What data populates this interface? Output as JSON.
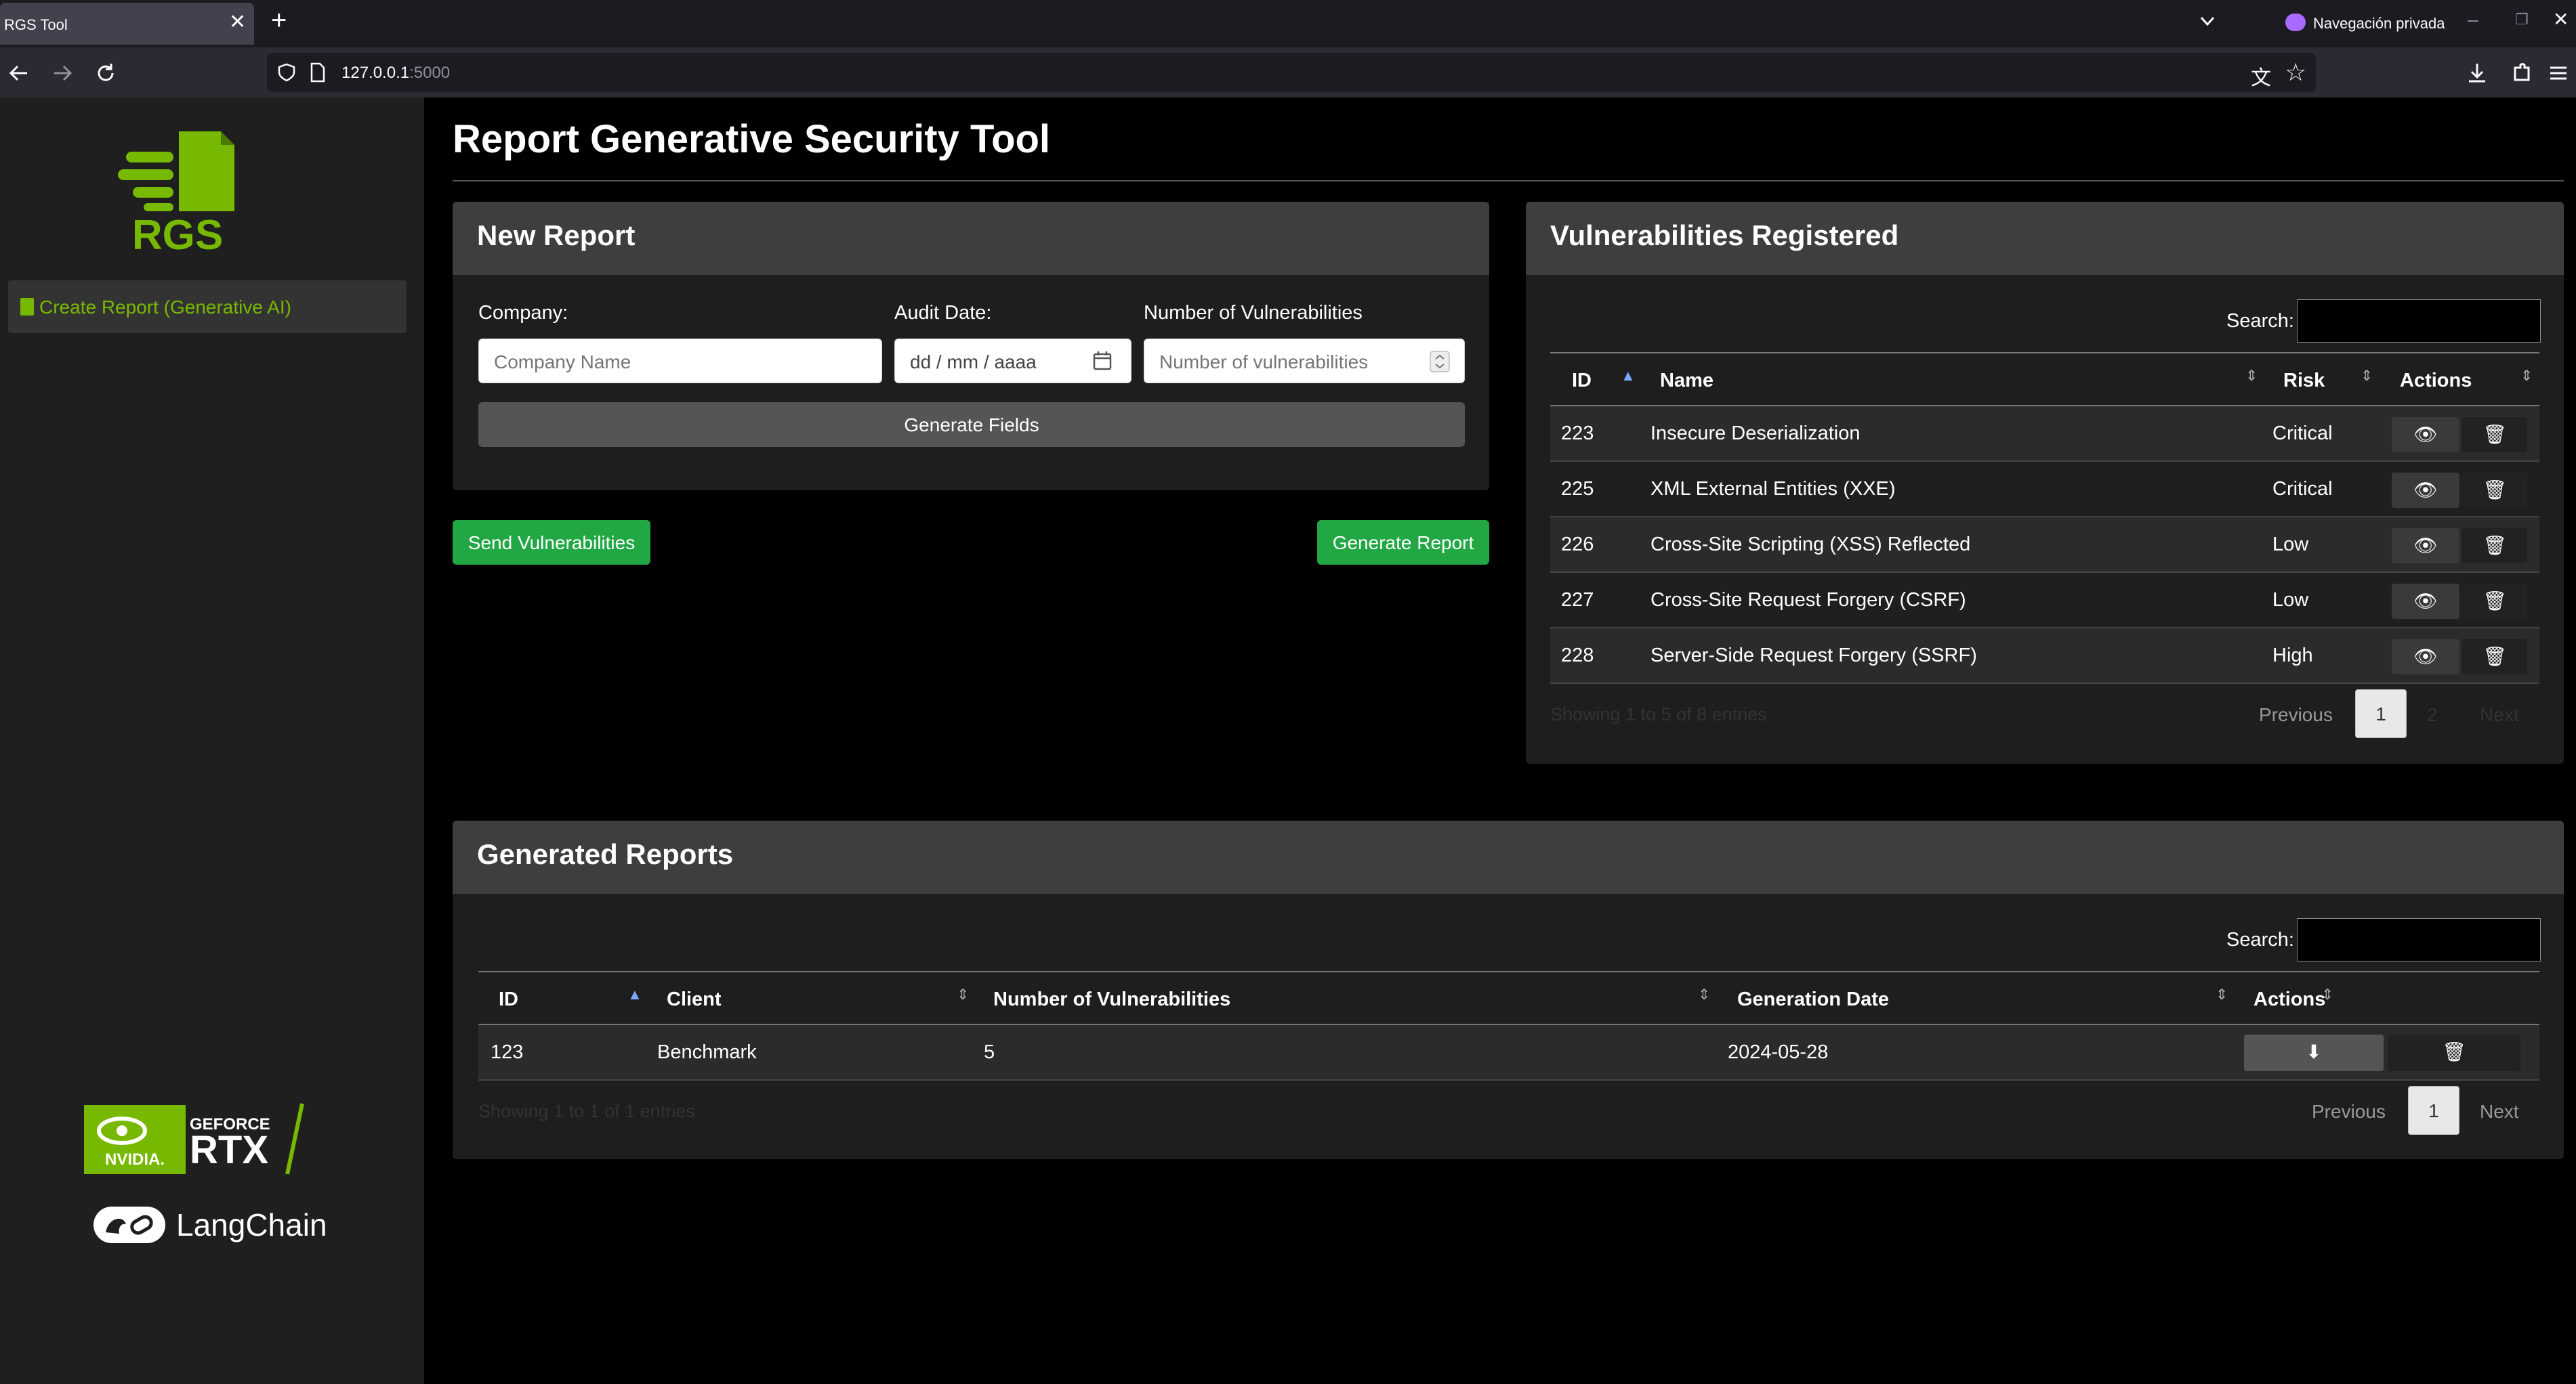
{
  "browser": {
    "tab_title": "RGS Tool",
    "tab_close": "✕",
    "new_tab": "+",
    "private_label": "Navegación privada",
    "url_host": "127.0.0.1",
    "url_port": ":5000"
  },
  "sidebar": {
    "logo_text": "RGS",
    "menu_item_label": "Create Report (Generative AI)",
    "nvidia_text": "NVIDIA.",
    "geforce_text": "GEFORCE",
    "rtx_text": "RTX",
    "langchain_text": "LangChain"
  },
  "page": {
    "title": "Report Generative Security Tool"
  },
  "new_report": {
    "title": "New Report",
    "company_label": "Company:",
    "company_placeholder": "Company Name",
    "audit_label": "Audit Date:",
    "audit_placeholder": "dd / mm / aaaa",
    "vuln_label": "Number of Vulnerabilities",
    "vuln_placeholder": "Number of vulnerabilities",
    "generate_fields": "Generate Fields",
    "send_vulns": "Send Vulnerabilities",
    "generate_report": "Generate Report"
  },
  "vulns": {
    "title": "Vulnerabilities Registered",
    "search_label": "Search:",
    "headers": {
      "id": "ID",
      "name": "Name",
      "risk": "Risk",
      "actions": "Actions"
    },
    "rows": [
      {
        "id": "223",
        "name": "Insecure Deserialization",
        "risk": "Critical"
      },
      {
        "id": "225",
        "name": "XML External Entities (XXE)",
        "risk": "Critical"
      },
      {
        "id": "226",
        "name": "Cross-Site Scripting (XSS) Reflected",
        "risk": "Low"
      },
      {
        "id": "227",
        "name": "Cross-Site Request Forgery (CSRF)",
        "risk": "Low"
      },
      {
        "id": "228",
        "name": "Server-Side Request Forgery (SSRF)",
        "risk": "High"
      }
    ],
    "info": "Showing 1 to 5 of 8 entries",
    "prev": "Previous",
    "page1": "1",
    "page2": "2",
    "next": "Next"
  },
  "reports": {
    "title": "Generated Reports",
    "search_label": "Search:",
    "headers": {
      "id": "ID",
      "client": "Client",
      "num": "Number of Vulnerabilities",
      "date": "Generation Date",
      "actions": "Actions"
    },
    "rows": [
      {
        "id": "123",
        "client": "Benchmark",
        "num": "5",
        "date": "2024-05-28"
      }
    ],
    "info": "Showing 1 to 1 of 1 entries",
    "prev": "Previous",
    "page1": "1",
    "next": "Next"
  },
  "colors": {
    "accent_green": "#76b900",
    "button_green": "#22a745"
  }
}
